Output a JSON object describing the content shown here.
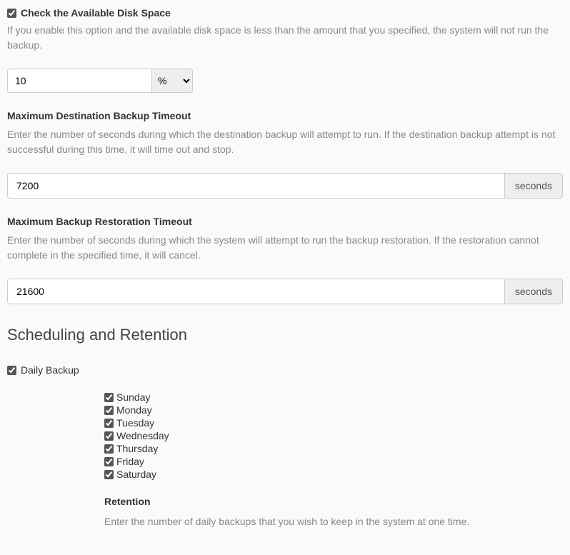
{
  "disk_check": {
    "title": "Check the Available Disk Space",
    "help": "If you enable this option and the available disk space is less than the amount that you specified, the system will not run the backup.",
    "value": "10",
    "unit": "%"
  },
  "dest_timeout": {
    "title": "Maximum Destination Backup Timeout",
    "help": "Enter the number of seconds during which the destination backup will attempt to run. If the destination backup attempt is not successful during this time, it will time out and stop.",
    "value": "7200",
    "suffix": "seconds"
  },
  "restore_timeout": {
    "title": "Maximum Backup Restoration Timeout",
    "help": "Enter the number of seconds during which the system will attempt to run the backup restoration. If the restoration cannot complete in the specified time, it will cancel.",
    "value": "21600",
    "suffix": "seconds"
  },
  "sched": {
    "heading": "Scheduling and Retention",
    "daily_label": "Daily Backup",
    "days": [
      {
        "label": "Sunday"
      },
      {
        "label": "Monday"
      },
      {
        "label": "Tuesday"
      },
      {
        "label": "Wednesday"
      },
      {
        "label": "Thursday"
      },
      {
        "label": "Friday"
      },
      {
        "label": "Saturday"
      }
    ],
    "retention_title": "Retention",
    "retention_help": "Enter the number of daily backups that you wish to keep in the system at one time."
  }
}
